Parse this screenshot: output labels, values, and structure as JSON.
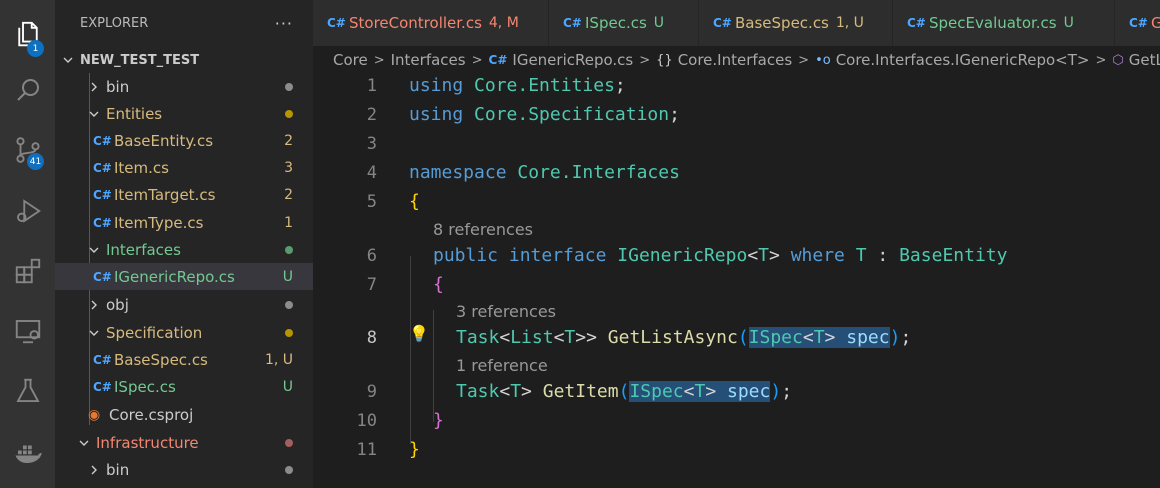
{
  "activity_bar": {
    "explorer_badge": "1",
    "scm_badge": "41"
  },
  "explorer": {
    "title": "EXPLORER",
    "more": "···",
    "project": "NEW_TEST_TEST",
    "items": [
      {
        "label": "bin",
        "status": "",
        "color": "#cccccc"
      },
      {
        "label": "Entities",
        "status": "",
        "color": "#d7ba7d"
      },
      {
        "label": "BaseEntity.cs",
        "status": "2",
        "color": "#d7ba7d"
      },
      {
        "label": "Item.cs",
        "status": "3",
        "color": "#d7ba7d"
      },
      {
        "label": "ItemTarget.cs",
        "status": "2",
        "color": "#d7ba7d"
      },
      {
        "label": "ItemType.cs",
        "status": "1",
        "color": "#d7ba7d"
      },
      {
        "label": "Interfaces",
        "status": "",
        "color": "#73c991"
      },
      {
        "label": "IGenericRepo.cs",
        "status": "U",
        "color": "#73c991"
      },
      {
        "label": "obj",
        "status": "",
        "color": "#cccccc"
      },
      {
        "label": "Specification",
        "status": "",
        "color": "#d7ba7d"
      },
      {
        "label": "BaseSpec.cs",
        "status": "1, U",
        "color": "#d7ba7d"
      },
      {
        "label": "ISpec.cs",
        "status": "U",
        "color": "#73c991"
      },
      {
        "label": "Core.csproj",
        "status": "",
        "color": "#cccccc"
      },
      {
        "label": "Infrastructure",
        "status": "",
        "color": "#f48771"
      },
      {
        "label": "bin",
        "status": "",
        "color": "#cccccc"
      }
    ]
  },
  "tabs": [
    {
      "label": "StoreController.cs",
      "status": "4, M",
      "color": "#f48771"
    },
    {
      "label": "ISpec.cs",
      "status": "U",
      "color": "#73c991"
    },
    {
      "label": "BaseSpec.cs",
      "status": "1, U",
      "color": "#d7ba7d"
    },
    {
      "label": "SpecEvaluator.cs",
      "status": "U",
      "color": "#73c991"
    },
    {
      "label": "Ge",
      "status": "",
      "color": "#f48771"
    }
  ],
  "breadcrumb": {
    "core": "Core",
    "interfaces": "Interfaces",
    "file": "IGenericRepo.cs",
    "namespace": "Core.Interfaces",
    "interface": "Core.Interfaces.IGenericRepo<T>",
    "method": "GetListAsy"
  },
  "code": {
    "line_numbers": [
      "1",
      "2",
      "3",
      "4",
      "5",
      "6",
      "7",
      "8",
      "9",
      "10",
      "11"
    ],
    "lens_8_refs": "8 references",
    "lens_3_refs": "3 references",
    "lens_1_ref": "1 reference",
    "l1_kw": "using",
    "l1_ns": "Core.Entities",
    "l1_end": ";",
    "l2_kw": "using",
    "l2_ns": "Core.Specification",
    "l2_end": ";",
    "l4_kw": "namespace",
    "l4_ns": "Core.Interfaces",
    "l5_brace": "{",
    "l6_public": "public",
    "l6_interface": "interface",
    "l6_name": "IGenericRepo",
    "l6_lt": "<",
    "l6_t": "T",
    "l6_gt": ">",
    "l6_where": "where",
    "l6_t2": "T",
    "l6_colon": ":",
    "l6_base": "BaseEntity",
    "l7_brace": "{",
    "l8_task": "Task",
    "l8_lt1": "<",
    "l8_list": "List",
    "l8_lt2": "<",
    "l8_t": "T",
    "l8_gt": ">>",
    "l8_method": "GetListAsync",
    "l8_po": "(",
    "l8_ispec": "ISpec",
    "l8_lt3": "<",
    "l8_t2": "T",
    "l8_gt3": ">",
    "l8_param": "spec",
    "l8_pc": ")",
    "l8_end": ";",
    "l9_task": "Task",
    "l9_lt": "<",
    "l9_t": "T",
    "l9_gt": ">",
    "l9_method": "GetItem",
    "l9_po": "(",
    "l9_ispec": "ISpec",
    "l9_lt2": "<",
    "l9_t2": "T",
    "l9_gt2": ">",
    "l9_param": "spec",
    "l9_pc": ")",
    "l9_end": ";",
    "l10_brace": "}",
    "l11_brace": "}"
  }
}
